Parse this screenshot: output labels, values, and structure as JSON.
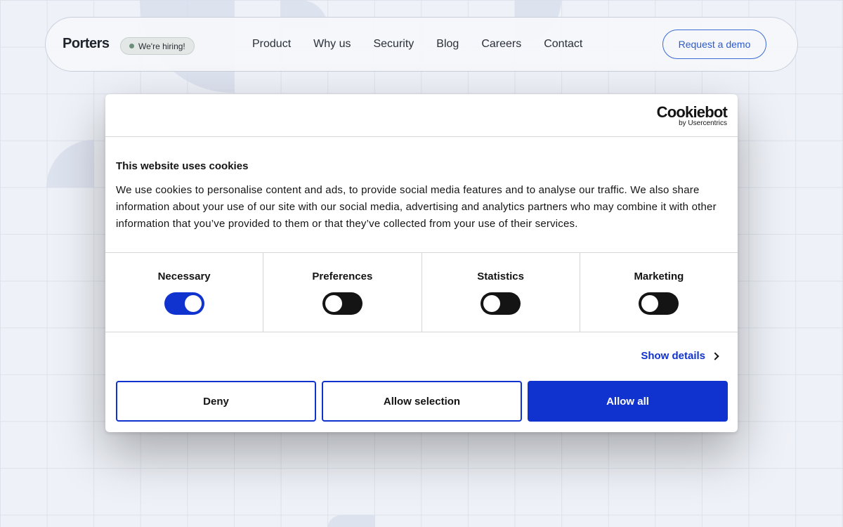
{
  "nav": {
    "logo": "Porters",
    "hiring_badge": "We're hiring!",
    "links": [
      "Product",
      "Why us",
      "Security",
      "Blog",
      "Careers",
      "Contact"
    ],
    "demo_button": "Request a demo"
  },
  "cookie_dialog": {
    "brand": "Cookiebot",
    "brand_sub": "by Usercentrics",
    "title": "This website uses cookies",
    "body": "We use cookies to personalise content and ads, to provide social media features and to analyse our traffic. We also share information about your use of our site with our social media, advertising and analytics partners who may combine it with other information that you’ve provided to them or that they’ve collected from your use of their services.",
    "toggles": [
      {
        "label": "Necessary",
        "on": true
      },
      {
        "label": "Preferences",
        "on": false
      },
      {
        "label": "Statistics",
        "on": false
      },
      {
        "label": "Marketing",
        "on": false
      }
    ],
    "show_details": "Show details",
    "buttons": {
      "deny": "Deny",
      "allow_selection": "Allow selection",
      "allow_all": "Allow all"
    }
  },
  "colors": {
    "accent": "#1032cf",
    "background": "#eef1f7"
  }
}
